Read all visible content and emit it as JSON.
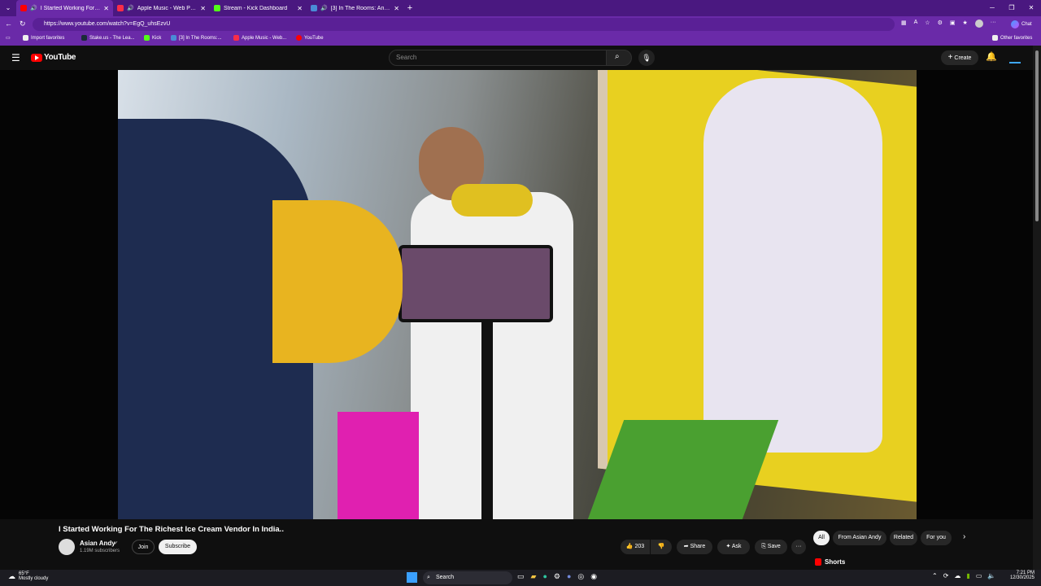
{
  "browser": {
    "tabs": [
      {
        "title": "I Started Working For The Richest Ice Cream Vendor In India..",
        "active": true,
        "favicon_color": "#ff0000"
      },
      {
        "title": "Apple Music - Web Player",
        "active": false,
        "favicon_color": "#fa2d48"
      },
      {
        "title": "Stream - Kick Dashboard",
        "active": false,
        "favicon_color": "#53fc18"
      },
      {
        "title": "[3] In The Rooms: An Online Me...",
        "active": false,
        "favicon_color": "#4a8bd6"
      }
    ],
    "url": "https://www.youtube.com/watch?v=EgQ_uhsEzvU",
    "chat_label": "Chat",
    "bookmarks": [
      {
        "label": "Import favorites"
      },
      {
        "label": "Stake.us - The Lea..."
      },
      {
        "label": "Kick"
      },
      {
        "label": "[3] In The Rooms:..."
      },
      {
        "label": "Apple Music - Web..."
      },
      {
        "label": "YouTube"
      }
    ],
    "other_favorites": "Other favorites"
  },
  "youtube": {
    "logo_text": "YouTube",
    "search_placeholder": "Search",
    "create_label": "Create",
    "video": {
      "title": "I Started Working For The Richest Ice Cream Vendor In India..",
      "channel": "Asian Andy",
      "subscribers": "1.19M subscribers",
      "join_label": "Join",
      "subscribe_label": "Subscribe",
      "likes": "203",
      "share_label": "Share",
      "ask_label": "Ask",
      "save_label": "Save"
    },
    "filter_chips": [
      "All",
      "From Asian Andy",
      "Related",
      "For you"
    ],
    "shorts_label": "Shorts"
  },
  "taskbar": {
    "weather_temp": "65°F",
    "weather_desc": "Mostly cloudy",
    "search_label": "Search",
    "time": "7:21 PM",
    "date": "12/30/2025"
  },
  "colors": {
    "tab_bar": "#4a1880",
    "chrome": "#6a2aa8",
    "yt_red": "#ff0000"
  }
}
